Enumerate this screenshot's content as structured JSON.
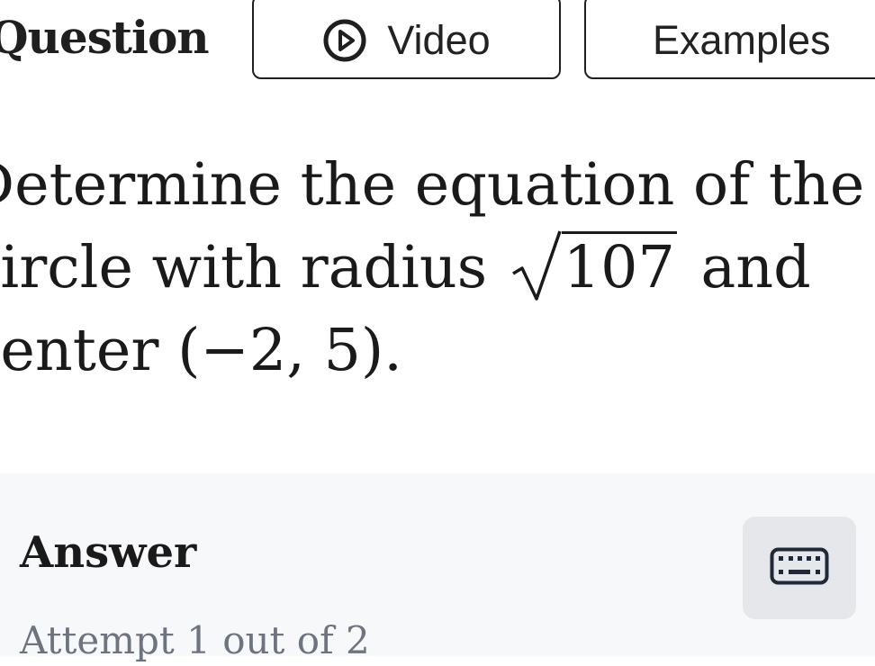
{
  "header": {
    "title": "Question",
    "video_label": "Video",
    "examples_label": "Examples"
  },
  "problem": {
    "line1": "Determine the equation of the",
    "line2_prefix": "circle with radius",
    "radicand": "107",
    "line2_suffix": "and",
    "line3_prefix": "center",
    "center_point": "(−2, 5)",
    "line3_suffix": "."
  },
  "answer": {
    "title": "Answer",
    "attempt_text": "Attempt 1 out of 2"
  },
  "icons": {
    "video": "play-circle-icon",
    "keyboard": "keyboard-icon"
  },
  "colors": {
    "text": "#1f1f1f",
    "answer_panel_bg": "#f7f8fa",
    "keyboard_button_bg": "#e6e7ea",
    "attempt_text": "#6d7480"
  }
}
